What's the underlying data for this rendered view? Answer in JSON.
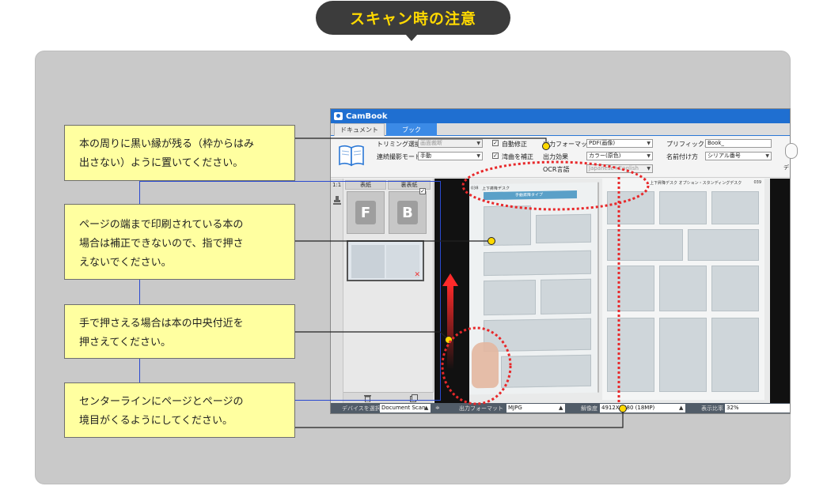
{
  "title": "スキャン時の注意",
  "app": {
    "name": "CamBook",
    "tabs": [
      "ドキュメント",
      "ブック"
    ],
    "toolbar": {
      "trimming_label": "トリミング選択",
      "trimming_value": "画面裁断",
      "continuous_label": "連続撮影モード",
      "continuous_value": "手動",
      "auto_correct": "自動修正",
      "curve_correct": "湾曲を補正",
      "output_format_label": "出力フォーマット",
      "output_format_value": "PDF(画像)",
      "output_effect_label": "出力効果",
      "output_effect_value": "カラー(原色)",
      "ocr_label": "OCR言語",
      "ocr_value": "Japanese+English",
      "prefix_label": "プリフィックス",
      "prefix_value": "Book_",
      "naming_label": "名前付け方",
      "naming_value": "シリアル番号",
      "cut_label": "デ"
    },
    "left_pane": {
      "zoom": "1:1",
      "front_label": "表紙",
      "back_label": "裏表紙",
      "front_letter": "F",
      "back_letter": "B"
    },
    "statusbar": {
      "device_label": "デバイスを選択",
      "device_value": "Document Scan",
      "output_label": "出力フォーマット",
      "output_value": "MJPG",
      "resolution_label": "解像度",
      "resolution_value": "4912X3680 (18MP)",
      "ratio_label": "表示比率",
      "ratio_value": "32%"
    }
  },
  "callouts": [
    {
      "line1": "本の周りに黒い縁が残る（枠からはみ",
      "line2": "出さない）ように置いてください。"
    },
    {
      "line1": "ページの端まで印刷されている本の",
      "line2": "場合は補正できないので、指で押さ",
      "line3": "えないでください。"
    },
    {
      "line1": "手で押さえる場合は本の中央付近を",
      "line2": "押さえてください。"
    },
    {
      "line1": "センターラインにページとページの",
      "line2": "境目がくるようにしてください。"
    }
  ],
  "book": {
    "left_header": "上下昇降デスク",
    "banner": "手動昇降タイプ",
    "right_header": "上下昇降デスク オプション・スタンディングデスク",
    "page_left": "038",
    "page_right": "039"
  },
  "colors": {
    "accent_yellow": "#ffd900",
    "callout_bg": "#ffffa0",
    "marker_red": "#e8282a",
    "app_blue": "#1f6fd1"
  }
}
